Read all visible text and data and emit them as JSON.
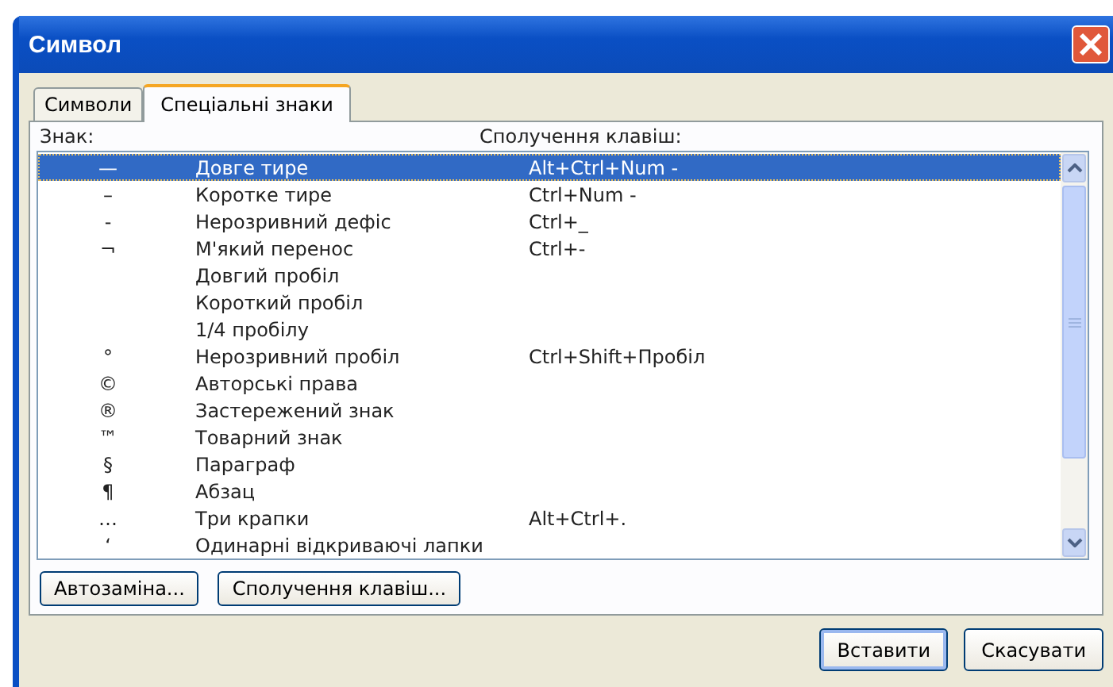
{
  "window": {
    "title": "Символ"
  },
  "tabs": [
    {
      "label": "Символи",
      "selected": false
    },
    {
      "label": "Спеціальні знаки",
      "selected": true
    }
  ],
  "list": {
    "columns": [
      "Знак:",
      "Сполучення клавіш:"
    ],
    "rows": [
      {
        "sign": "—",
        "name": "Довге тире",
        "shortcut": "Alt+Ctrl+Num -",
        "selected": true
      },
      {
        "sign": "–",
        "name": "Коротке тире",
        "shortcut": "Ctrl+Num -",
        "selected": false
      },
      {
        "sign": "-",
        "name": "Нерозривний дефіс",
        "shortcut": "Ctrl+_",
        "selected": false
      },
      {
        "sign": "¬",
        "name": "М'який перенос",
        "shortcut": "Ctrl+-",
        "selected": false
      },
      {
        "name": "Довгий пробіл",
        "selected": false
      },
      {
        "name": "Короткий пробіл",
        "selected": false
      },
      {
        "name": "1/4 пробілу",
        "selected": false
      },
      {
        "sign": "°",
        "name": "Нерозривний пробіл",
        "shortcut": "Ctrl+Shift+Пробіл",
        "selected": false
      },
      {
        "sign": "©",
        "name": "Авторські права",
        "selected": false
      },
      {
        "sign": "®",
        "name": "Застережений знак",
        "selected": false
      },
      {
        "sign": "™",
        "name": "Товарний знак",
        "selected": false
      },
      {
        "sign": "§",
        "name": "Параграф",
        "selected": false
      },
      {
        "sign": "¶",
        "name": "Абзац",
        "selected": false
      },
      {
        "sign": "…",
        "name": "Три крапки",
        "shortcut": "Alt+Ctrl+.",
        "selected": false
      },
      {
        "sign": "‘",
        "name": "Одинарні відкриваючі лапки",
        "selected": false
      }
    ]
  },
  "panel_buttons": [
    "Автозаміна...",
    "Сполучення клавіш..."
  ],
  "dialog_buttons": [
    {
      "label": "Вставити",
      "default": true
    },
    {
      "label": "Скасувати",
      "default": false
    }
  ]
}
